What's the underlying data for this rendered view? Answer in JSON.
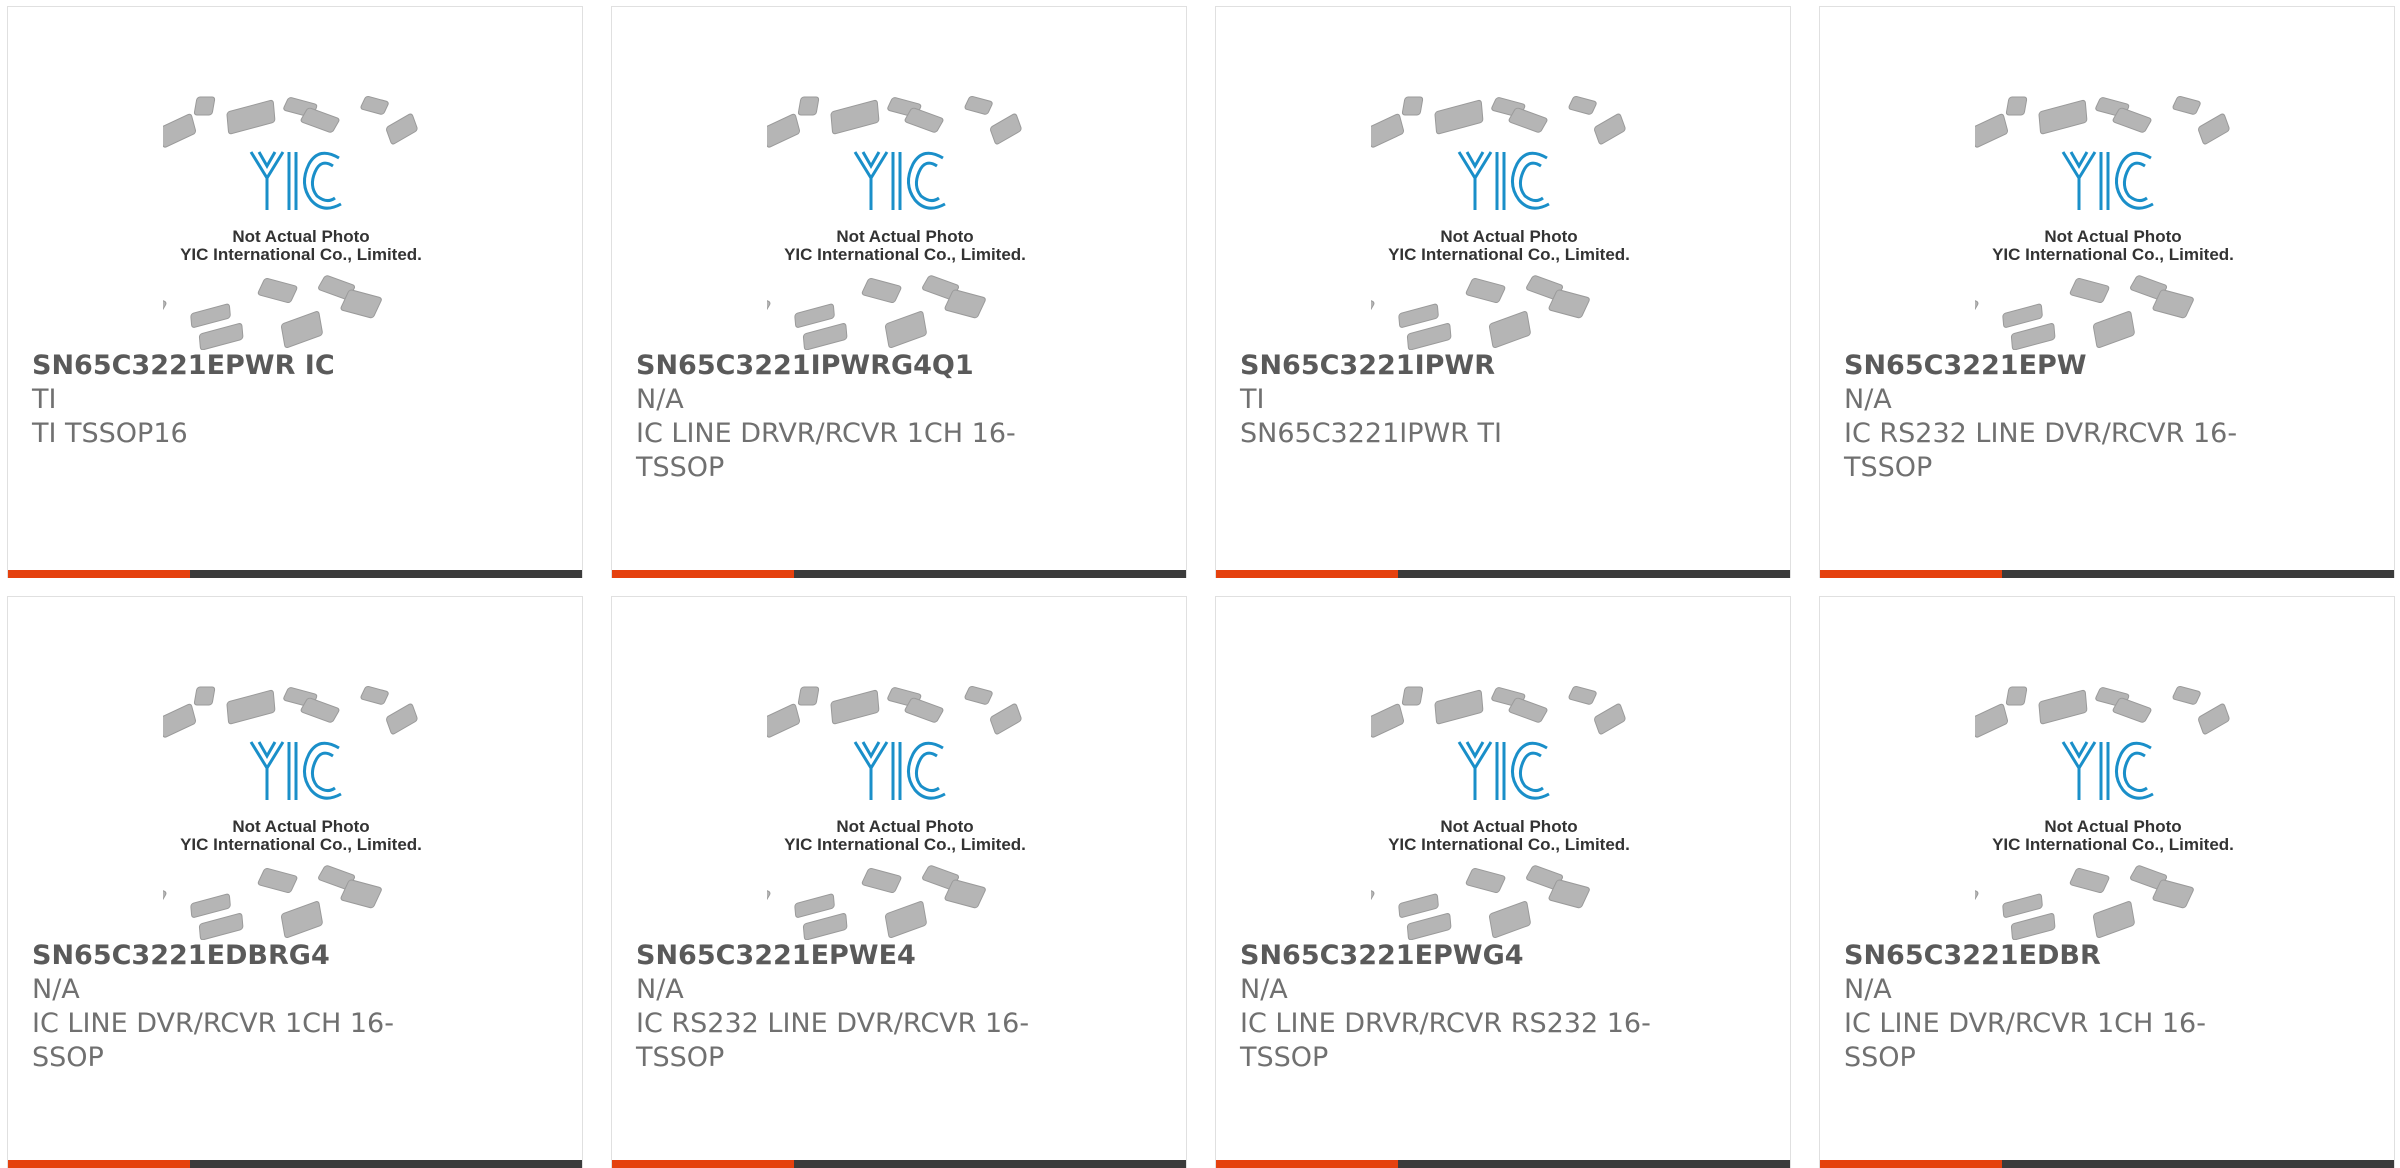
{
  "placeholder": {
    "line1": "Not Actual Photo",
    "line2": "YIC International Co., Limited."
  },
  "colors": {
    "accent": "#e5410e",
    "bar": "#3b3b3b",
    "logo": "#1a8fc9"
  },
  "products": [
    {
      "part": "SN65C3221EPWR IC",
      "manufacturer": "TI",
      "description": "TI TSSOP16"
    },
    {
      "part": "SN65C3221IPWRG4Q1",
      "manufacturer": "N/A",
      "description": "IC LINE DRVR/RCVR 1CH 16-TSSOP"
    },
    {
      "part": "SN65C3221IPWR",
      "manufacturer": "TI",
      "description": "SN65C3221IPWR TI"
    },
    {
      "part": "SN65C3221EPW",
      "manufacturer": "N/A",
      "description": "IC RS232 LINE DVR/RCVR 16-TSSOP"
    },
    {
      "part": "SN65C3221EDBRG4",
      "manufacturer": "N/A",
      "description": "IC LINE DVR/RCVR 1CH 16-SSOP"
    },
    {
      "part": "SN65C3221EPWE4",
      "manufacturer": "N/A",
      "description": "IC RS232 LINE DVR/RCVR 16-TSSOP"
    },
    {
      "part": "SN65C3221EPWG4",
      "manufacturer": "N/A",
      "description": "IC LINE DRVR/RCVR RS232 16-TSSOP"
    },
    {
      "part": "SN65C3221EDBR",
      "manufacturer": "N/A",
      "description": "IC LINE DVR/RCVR 1CH 16-SSOP"
    }
  ]
}
